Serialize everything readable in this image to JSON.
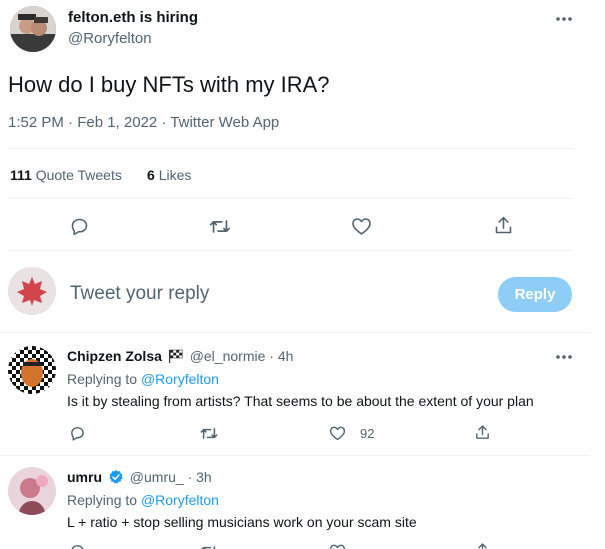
{
  "tweet": {
    "author_name": "felton.eth is hiring",
    "author_handle": "@Roryfelton",
    "text": "How do I buy NFTs with my IRA?",
    "meta": "1:52 PM · Feb 1, 2022 · Twitter Web App",
    "stats": {
      "quote_count": "111",
      "quote_label": "Quote Tweets",
      "like_count": "6",
      "like_label": "Likes"
    }
  },
  "composer": {
    "placeholder": "Tweet your reply",
    "reply_button": "Reply"
  },
  "replies": [
    {
      "name": "Chipzen Zolsa",
      "handle": "@el_normie",
      "time": "4h",
      "replying_prefix": "Replying to",
      "replying_to": "@Roryfelton",
      "text": "Is it by stealing from artists? That seems to be about the extent of your plan",
      "like_count": "92"
    },
    {
      "name": "umru",
      "handle": "@umru_",
      "time": "3h",
      "replying_prefix": "Replying to",
      "replying_to": "@Roryfelton",
      "text": "L + ratio + stop selling musicians work on your scam site"
    }
  ],
  "colors": {
    "accent": "#1d9bf0",
    "reply_button_disabled": "#8ecdf8",
    "muted_text": "#536471",
    "divider": "#eff3f4"
  }
}
